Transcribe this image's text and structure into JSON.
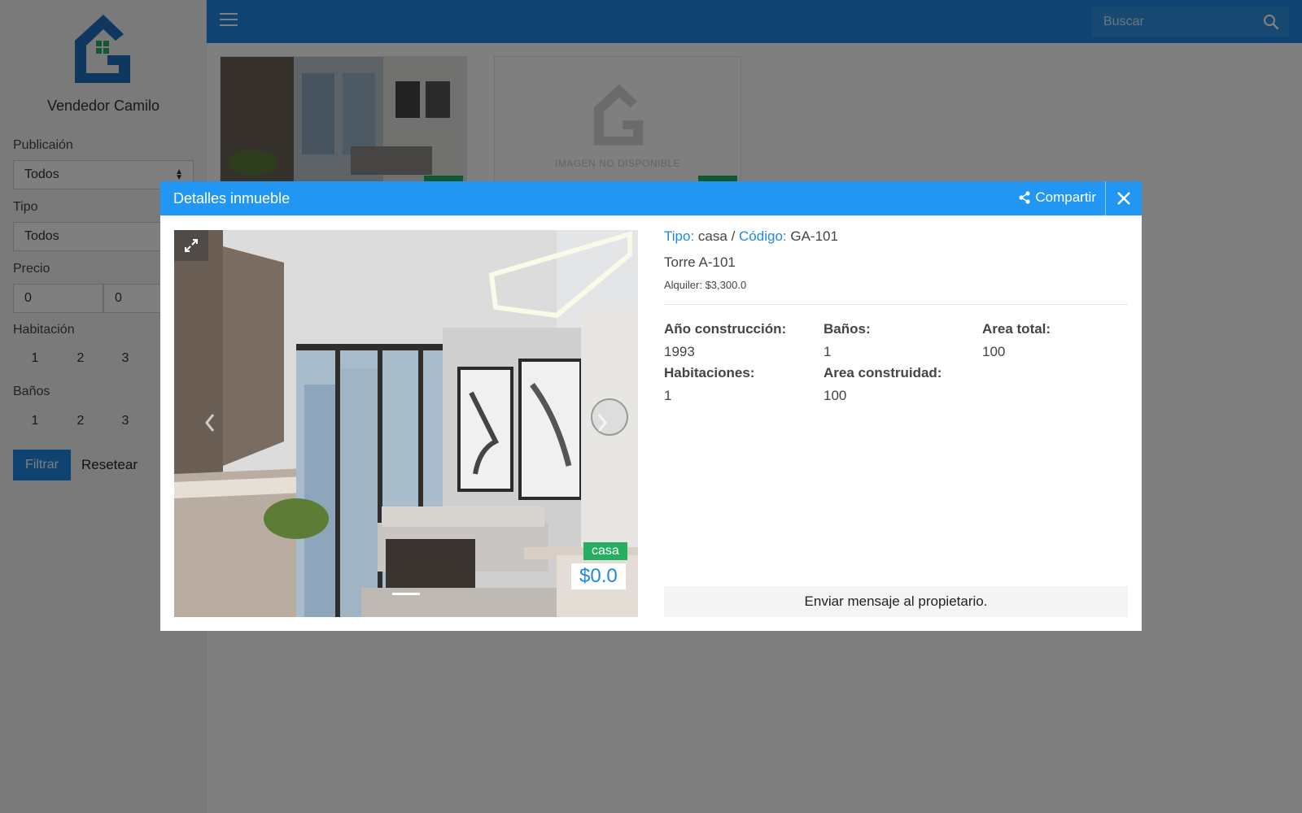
{
  "sidebar": {
    "seller_name": "Vendedor Camilo",
    "publication_label": "Publicaión",
    "publication_value": "Todos",
    "type_label": "Tipo",
    "type_value": "Todos",
    "price_label": "Precio",
    "price_min": "0",
    "price_max": "0",
    "rooms_label": "Habitación",
    "rooms_options": [
      "1",
      "2",
      "3"
    ],
    "baths_label": "Baños",
    "baths_options": [
      "1",
      "2",
      "3"
    ],
    "filter_button": "Filtrar",
    "reset_button": "Resetear"
  },
  "topbar": {
    "search_placeholder": "Buscar"
  },
  "cards": {
    "no_image_text": "IMAGEN NO DISPONIBLE"
  },
  "modal": {
    "title": "Detalles inmueble",
    "share_label": "Compartir",
    "type_label": "Tipo:",
    "type_value": "casa",
    "separator": "/",
    "code_label": "Código:",
    "code_value": "GA-101",
    "property_name": "Torre A-101",
    "rent": "Alquiler: $3,300.0",
    "photo_type_badge": "casa",
    "photo_price": "$0.0",
    "details": {
      "year_label": "Año construcción:",
      "year_value": "1993",
      "baths_label": "Baños:",
      "baths_value": "1",
      "total_area_label": "Area total:",
      "total_area_value": "100",
      "rooms_label": "Habitaciones:",
      "rooms_value": "1",
      "built_area_label": "Area construidad:",
      "built_area_value": "100"
    },
    "contact_button": "Enviar mensaje al propietario."
  },
  "colors": {
    "primary": "#1e88e5",
    "header": "#2196f3",
    "badge_green": "#27ae60"
  },
  "icons": [
    "house-logo-icon",
    "hamburger-icon",
    "search-icon",
    "share-icon",
    "close-icon",
    "expand-icon",
    "chevron-left-icon",
    "chevron-right-icon"
  ]
}
